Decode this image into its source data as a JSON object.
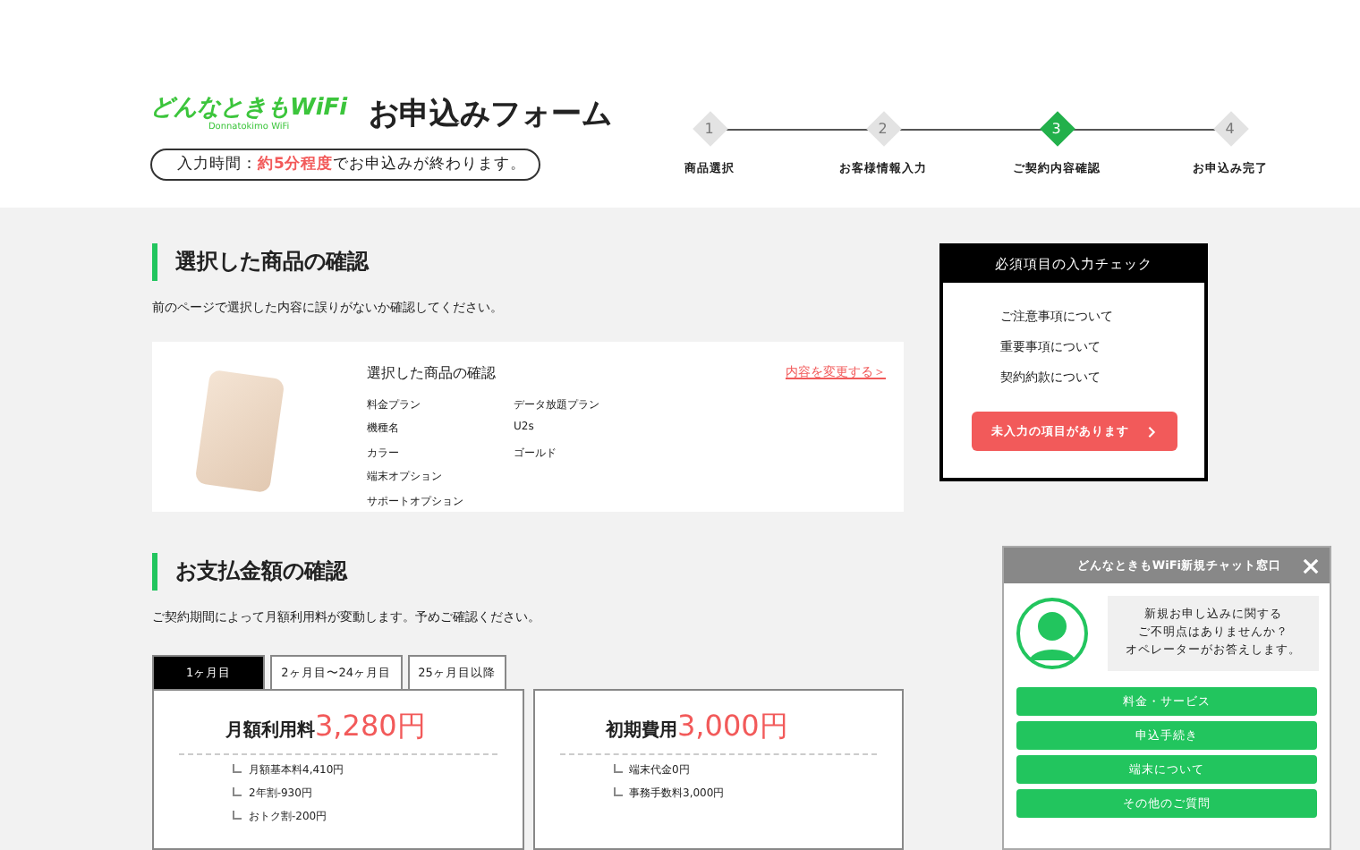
{
  "header": {
    "logo": "どんなときもWiFi",
    "logo_sub": "Donnatokimo WiFi",
    "title": "お申込みフォーム",
    "time_notice": "入力時間：**約5分程度**でお申込みが終わります。"
  },
  "steps": [
    {
      "number": "1",
      "label": "商品選択",
      "selected": false
    },
    {
      "number": "2",
      "label": "お客様情報入力",
      "selected": false
    },
    {
      "number": "3",
      "label": "ご契約内容確認",
      "selected": true
    },
    {
      "number": "4",
      "label": "お申込み完了",
      "selected": false
    }
  ],
  "product_section": {
    "heading": "選択した商品の確認",
    "description": "前のページで選択した内容に誤りがないか確認してください。",
    "card_title": "選択した商品の確認",
    "change_link": "内容を変更する＞",
    "rows": [
      {
        "label": "料金プラン",
        "value": "データ放題プラン"
      },
      {
        "label": "機種名",
        "value": "U2s"
      },
      {
        "label": "カラー",
        "value": "ゴールド"
      },
      {
        "label": "端末オプション"
      },
      {
        "label": "サポートオプション"
      }
    ]
  },
  "payment_section": {
    "heading": "お支払金額の確認",
    "description": "ご契約期間によって月額利用料が変動します。予めご確認ください。",
    "tabs": [
      {
        "label": "1ヶ月目",
        "selected": true
      },
      {
        "label": "2ヶ月目〜24ヶ月目",
        "selected": false
      },
      {
        "label": "25ヶ月目以降",
        "selected": false
      }
    ],
    "cards": [
      {
        "title": "月額利用料",
        "amount": "3,280円",
        "items": [
          "月額基本料4,410円",
          "2年割-930円",
          "おトク割-200円"
        ]
      },
      {
        "title": "初期費用",
        "amount": "3,000円",
        "items": [
          "端末代金0円",
          "事務手数料3,000円"
        ]
      }
    ]
  },
  "required_check": {
    "title": "必須項目の入力チェック",
    "items": [
      "ご注意事項について",
      "重要事項について",
      "契約約款について"
    ],
    "button": "未入力の項目があります"
  },
  "chat": {
    "title": "どんなときもWiFi新規チャット窓口",
    "message": [
      "新規お申し込みに関する",
      "ご不明点はありませんか？",
      "オペレーターがお答えします。"
    ],
    "options": [
      "料金・サービス",
      "申込手続き",
      "端末について",
      "その他のご質問"
    ]
  }
}
